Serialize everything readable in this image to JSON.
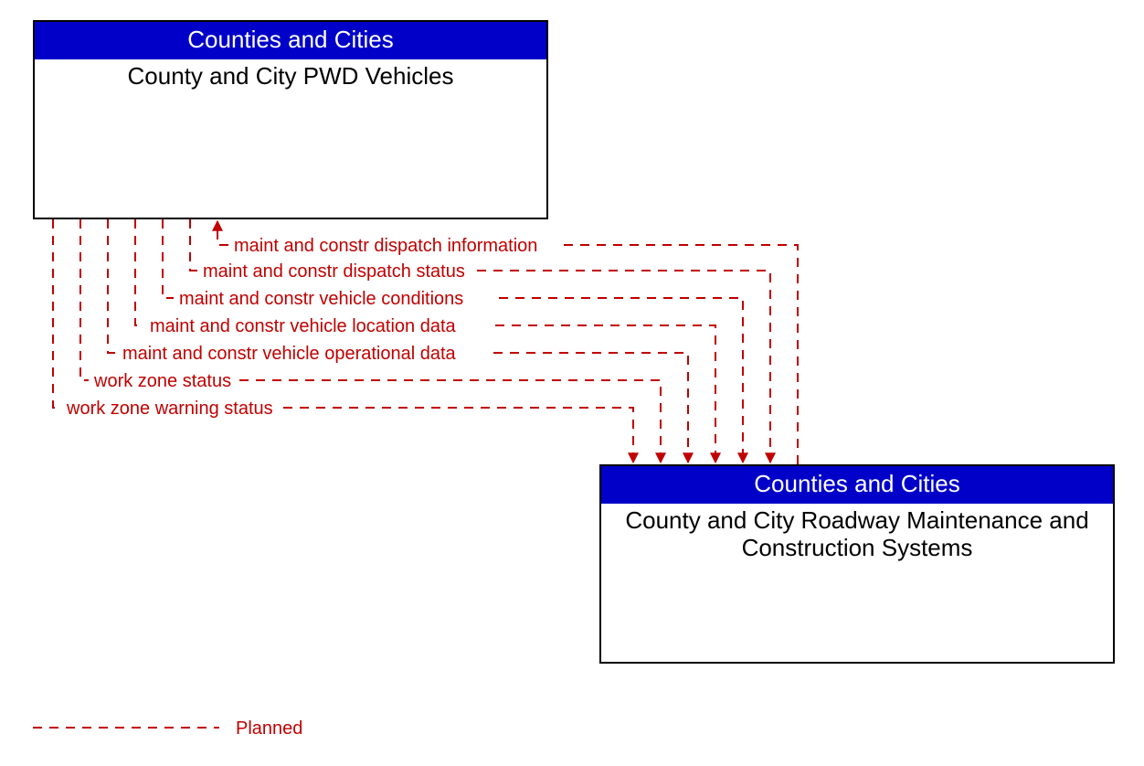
{
  "colors": {
    "header_bg": "#0000c8",
    "header_text": "#ffffff",
    "box_border": "#000000",
    "flow_color": "#c00000",
    "body_text": "#000000"
  },
  "boxes": {
    "top": {
      "header": "Counties and Cities",
      "body": "County and City PWD Vehicles"
    },
    "bottom": {
      "header": "Counties and Cities",
      "body": "County and City Roadway Maintenance and Construction Systems"
    }
  },
  "flows": [
    {
      "label": "maint and constr dispatch information",
      "direction": "to_top"
    },
    {
      "label": "maint and constr dispatch status",
      "direction": "to_bottom"
    },
    {
      "label": "maint and constr vehicle conditions",
      "direction": "to_bottom"
    },
    {
      "label": "maint and constr vehicle location data",
      "direction": "to_bottom"
    },
    {
      "label": "maint and constr vehicle operational data",
      "direction": "to_bottom"
    },
    {
      "label": "work zone status",
      "direction": "to_bottom"
    },
    {
      "label": "work zone warning status",
      "direction": "to_bottom"
    }
  ],
  "legend": {
    "label": "Planned"
  }
}
